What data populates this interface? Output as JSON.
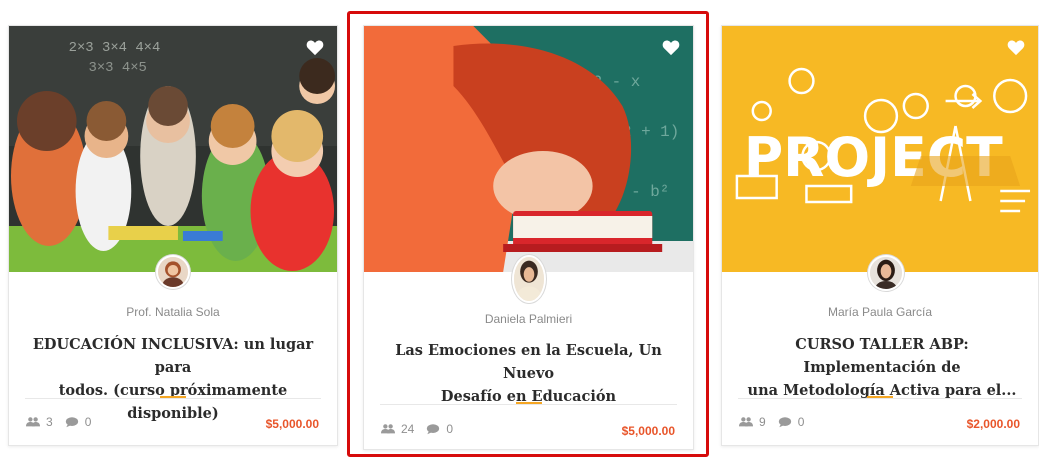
{
  "colors": {
    "accent": "#f5a623",
    "price": "#e8552a",
    "highlight": "#d60b0b"
  },
  "courses": [
    {
      "image": "classroom-children-photo",
      "author": "Prof. Natalia Sola",
      "title_line1": "EDUCACIÓN INCLUSIVA: un lugar para",
      "title_line2": "todos. (curso próximamente disponible)",
      "students": "3",
      "comments": "0",
      "price": "$5,000.00"
    },
    {
      "image": "tired-teacher-photo",
      "author": "Daniela Palmieri",
      "title_line1": "Las Emociones en la Escuela, Un Nuevo",
      "title_line2": "Desafío en Educación",
      "students": "24",
      "comments": "0",
      "price": "$5,000.00"
    },
    {
      "image": "project-illustration",
      "author": "María Paula García",
      "title_line1": "CURSO TALLER ABP: Implementación de",
      "title_line2": "una Metodología Activa para el...",
      "students": "9",
      "comments": "0",
      "price": "$2,000.00"
    }
  ]
}
